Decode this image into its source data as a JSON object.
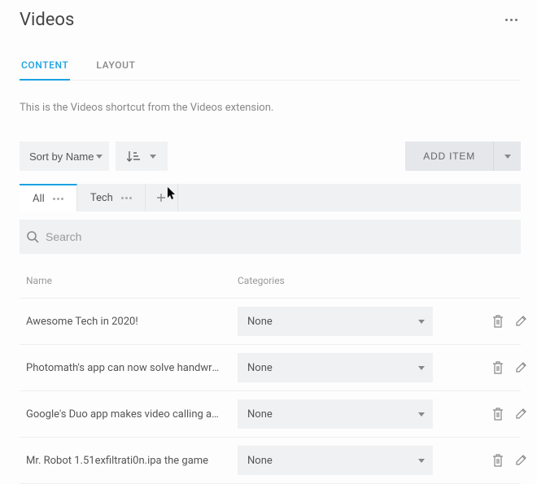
{
  "header": {
    "title": "Videos"
  },
  "main_tabs": {
    "content": "CONTENT",
    "layout": "LAYOUT"
  },
  "description": "This is the Videos shortcut from the Videos extension.",
  "toolbar": {
    "sort_label": "Sort by Name",
    "add_item_label": "ADD ITEM"
  },
  "filter_tabs": {
    "all": "All",
    "tech": "Tech"
  },
  "search": {
    "placeholder": "Search"
  },
  "table": {
    "col_name": "Name",
    "col_categories": "Categories",
    "category_none": "None",
    "rows": [
      {
        "name": "Awesome Tech in 2020!",
        "category": "None"
      },
      {
        "name": "Photomath's app can now solve handwritten math ...",
        "category": "None"
      },
      {
        "name": "Google's Duo app makes video calling as easy as vo...",
        "category": "None"
      },
      {
        "name": "Mr. Robot 1.51exfiltrati0n.ipa the game",
        "category": "None"
      }
    ]
  }
}
